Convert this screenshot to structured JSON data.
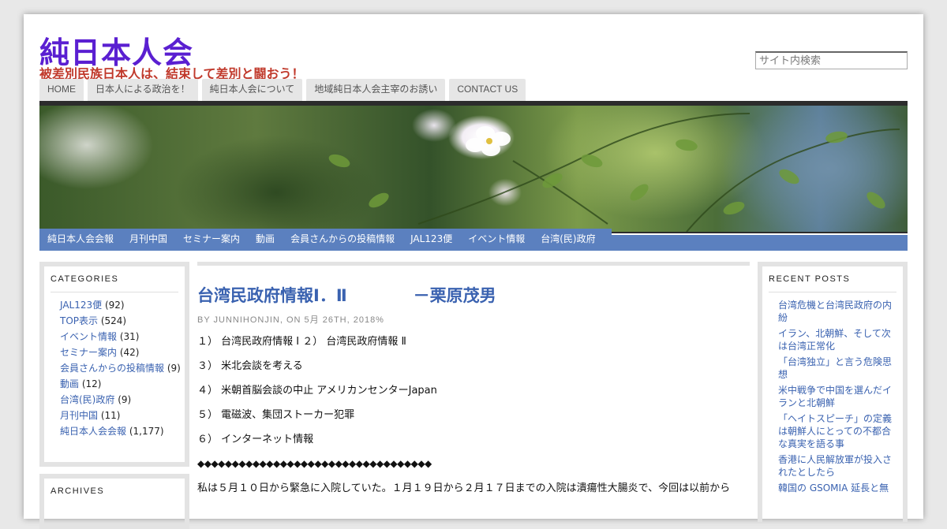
{
  "site": {
    "title": "純日本人会",
    "tagline": "被差別民族日本人は、結束して差別と闘おう！",
    "search_placeholder": "サイト内検索"
  },
  "top_nav": [
    "HOME",
    "日本人による政治を！",
    "純日本人会について",
    "地域純日本人会主宰のお誘い",
    "CONTACT US"
  ],
  "category_nav": [
    "純日本人会会報",
    "月刊中国",
    "セミナー案内",
    "動画",
    "会員さんからの投稿情報",
    "JAL123便",
    "イベント情報",
    "台湾(民)政府"
  ],
  "left_sidebar": {
    "categories_title": "CATEGORIES",
    "categories": [
      {
        "name": "JAL123便",
        "count": "(92)"
      },
      {
        "name": "TOP表示",
        "count": "(524)"
      },
      {
        "name": "イベント情報",
        "count": "(31)"
      },
      {
        "name": "セミナー案内",
        "count": "(42)"
      },
      {
        "name": "会員さんからの投稿情報",
        "count": "(9)"
      },
      {
        "name": "動画",
        "count": "(12)"
      },
      {
        "name": "台湾(民)政府",
        "count": "(9)"
      },
      {
        "name": "月刊中国",
        "count": "(11)"
      },
      {
        "name": "純日本人会会報",
        "count": "(1,177)"
      }
    ],
    "archives_title": "ARCHIVES"
  },
  "post": {
    "title": "台湾民政府情報Ⅰ．Ⅱ　　　　－栗原茂男",
    "meta": "BY JUNNIHONJIN, ON 5月 26TH, 2018%",
    "lines": [
      "１） 台湾民政府情報 Ⅰ ２） 台湾民政府情報 Ⅱ",
      "３） 米北会談を考える",
      "４） 米朝首脳会談の中止 アメリカンセンターJapan",
      "５） 電磁波、集団ストーカー犯罪",
      "６） インターネット情報",
      "◆◆◆◆◆◆◆◆◆◆◆◆◆◆◆◆◆◆◆◆◆◆◆◆◆◆◆◆◆◆◆◆◆◆"
    ],
    "paragraph": "私は５月１０日から緊急に入院していた。１月１９日から２月１７日までの入院は潰瘍性大腸炎で、今回は以前から"
  },
  "right_sidebar": {
    "recent_title": "RECENT POSTS",
    "recent_posts": [
      "台湾危機と台湾民政府の内紛",
      "イラン、北朝鮮、そして次は台湾正常化",
      "「台湾独立」と言う危険思想",
      "米中戦争で中国を選んだイランと北朝鮮",
      "「ヘイトスピーチ」の定義は朝鮮人にとっての不都合な真実を語る事",
      "香港に人民解放軍が投入されたとしたら",
      "韓国の GSOMIA 延長と無"
    ]
  }
}
